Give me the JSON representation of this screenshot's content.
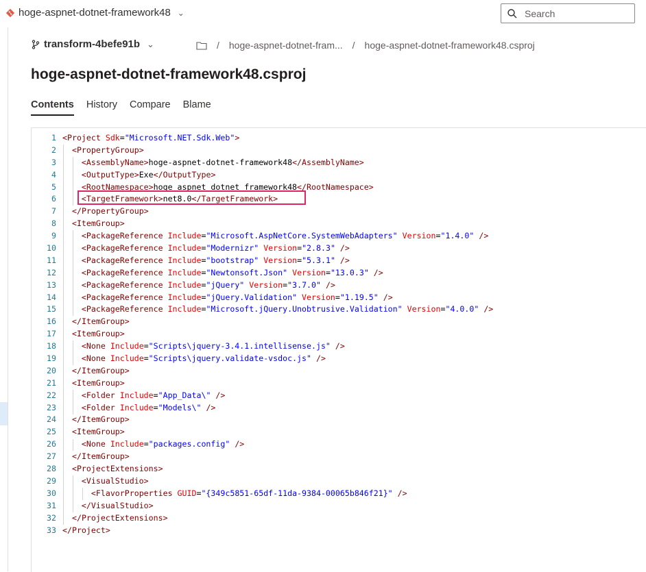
{
  "repo": {
    "name": "hoge-aspnet-dotnet-framework48"
  },
  "search": {
    "placeholder": "Search"
  },
  "branch": {
    "name": "transform-4befe91b"
  },
  "breadcrumb": {
    "folder": "hoge-aspnet-dotnet-fram...",
    "file": "hoge-aspnet-dotnet-framework48.csproj"
  },
  "page": {
    "title": "hoge-aspnet-dotnet-framework48.csproj"
  },
  "tabs": [
    {
      "label": "Contents",
      "active": true
    },
    {
      "label": "History",
      "active": false
    },
    {
      "label": "Compare",
      "active": false
    },
    {
      "label": "Blame",
      "active": false
    }
  ],
  "colors": {
    "highlight_box": "#e0245e",
    "tag": "#800000",
    "attribute": "#e50000",
    "string": "#0000ff",
    "line_number": "#237893"
  },
  "code_lines": [
    {
      "n": "1",
      "indent": 0,
      "parts": [
        [
          "p",
          "<"
        ],
        [
          "t",
          "Project"
        ],
        [
          "s",
          " "
        ],
        [
          "a",
          "Sdk"
        ],
        [
          "x",
          "="
        ],
        [
          "v",
          "\"Microsoft.NET.Sdk.Web\""
        ],
        [
          "p",
          ">"
        ]
      ]
    },
    {
      "n": "2",
      "indent": 1,
      "parts": [
        [
          "p",
          "<"
        ],
        [
          "t",
          "PropertyGroup"
        ],
        [
          "p",
          ">"
        ]
      ]
    },
    {
      "n": "3",
      "indent": 2,
      "parts": [
        [
          "p",
          "<"
        ],
        [
          "t",
          "AssemblyName"
        ],
        [
          "p",
          ">"
        ],
        [
          "x",
          "hoge-aspnet-dotnet-framework48"
        ],
        [
          "p",
          "</"
        ],
        [
          "t",
          "AssemblyName"
        ],
        [
          "p",
          ">"
        ]
      ]
    },
    {
      "n": "4",
      "indent": 2,
      "parts": [
        [
          "p",
          "<"
        ],
        [
          "t",
          "OutputType"
        ],
        [
          "p",
          ">"
        ],
        [
          "x",
          "Exe"
        ],
        [
          "p",
          "</"
        ],
        [
          "t",
          "OutputType"
        ],
        [
          "p",
          ">"
        ]
      ]
    },
    {
      "n": "5",
      "indent": 2,
      "parts": [
        [
          "p",
          "<"
        ],
        [
          "t",
          "RootNamespace"
        ],
        [
          "p",
          ">"
        ],
        [
          "x",
          "hoge_aspnet_dotnet_framework48"
        ],
        [
          "p",
          "</"
        ],
        [
          "t",
          "RootNamespace"
        ],
        [
          "p",
          ">"
        ]
      ]
    },
    {
      "n": "6",
      "indent": 2,
      "parts": [
        [
          "p",
          "<"
        ],
        [
          "t",
          "TargetFramework"
        ],
        [
          "p",
          ">"
        ],
        [
          "x",
          "net8.0"
        ],
        [
          "p",
          "</"
        ],
        [
          "t",
          "TargetFramework"
        ],
        [
          "p",
          ">"
        ]
      ]
    },
    {
      "n": "7",
      "indent": 1,
      "parts": [
        [
          "p",
          "</"
        ],
        [
          "t",
          "PropertyGroup"
        ],
        [
          "p",
          ">"
        ]
      ]
    },
    {
      "n": "8",
      "indent": 1,
      "parts": [
        [
          "p",
          "<"
        ],
        [
          "t",
          "ItemGroup"
        ],
        [
          "p",
          ">"
        ]
      ]
    },
    {
      "n": "9",
      "indent": 2,
      "parts": [
        [
          "p",
          "<"
        ],
        [
          "t",
          "PackageReference"
        ],
        [
          "s",
          " "
        ],
        [
          "a",
          "Include"
        ],
        [
          "x",
          "="
        ],
        [
          "v",
          "\"Microsoft.AspNetCore.SystemWebAdapters\""
        ],
        [
          "s",
          " "
        ],
        [
          "a",
          "Version"
        ],
        [
          "x",
          "="
        ],
        [
          "v",
          "\"1.4.0\""
        ],
        [
          "s",
          " "
        ],
        [
          "p",
          "/>"
        ]
      ]
    },
    {
      "n": "10",
      "indent": 2,
      "parts": [
        [
          "p",
          "<"
        ],
        [
          "t",
          "PackageReference"
        ],
        [
          "s",
          " "
        ],
        [
          "a",
          "Include"
        ],
        [
          "x",
          "="
        ],
        [
          "v",
          "\"Modernizr\""
        ],
        [
          "s",
          " "
        ],
        [
          "a",
          "Version"
        ],
        [
          "x",
          "="
        ],
        [
          "v",
          "\"2.8.3\""
        ],
        [
          "s",
          " "
        ],
        [
          "p",
          "/>"
        ]
      ]
    },
    {
      "n": "11",
      "indent": 2,
      "parts": [
        [
          "p",
          "<"
        ],
        [
          "t",
          "PackageReference"
        ],
        [
          "s",
          " "
        ],
        [
          "a",
          "Include"
        ],
        [
          "x",
          "="
        ],
        [
          "v",
          "\"bootstrap\""
        ],
        [
          "s",
          " "
        ],
        [
          "a",
          "Version"
        ],
        [
          "x",
          "="
        ],
        [
          "v",
          "\"5.3.1\""
        ],
        [
          "s",
          " "
        ],
        [
          "p",
          "/>"
        ]
      ]
    },
    {
      "n": "12",
      "indent": 2,
      "parts": [
        [
          "p",
          "<"
        ],
        [
          "t",
          "PackageReference"
        ],
        [
          "s",
          " "
        ],
        [
          "a",
          "Include"
        ],
        [
          "x",
          "="
        ],
        [
          "v",
          "\"Newtonsoft.Json\""
        ],
        [
          "s",
          " "
        ],
        [
          "a",
          "Version"
        ],
        [
          "x",
          "="
        ],
        [
          "v",
          "\"13.0.3\""
        ],
        [
          "s",
          " "
        ],
        [
          "p",
          "/>"
        ]
      ]
    },
    {
      "n": "13",
      "indent": 2,
      "parts": [
        [
          "p",
          "<"
        ],
        [
          "t",
          "PackageReference"
        ],
        [
          "s",
          " "
        ],
        [
          "a",
          "Include"
        ],
        [
          "x",
          "="
        ],
        [
          "v",
          "\"jQuery\""
        ],
        [
          "s",
          " "
        ],
        [
          "a",
          "Version"
        ],
        [
          "x",
          "="
        ],
        [
          "v",
          "\"3.7.0\""
        ],
        [
          "s",
          " "
        ],
        [
          "p",
          "/>"
        ]
      ]
    },
    {
      "n": "14",
      "indent": 2,
      "parts": [
        [
          "p",
          "<"
        ],
        [
          "t",
          "PackageReference"
        ],
        [
          "s",
          " "
        ],
        [
          "a",
          "Include"
        ],
        [
          "x",
          "="
        ],
        [
          "v",
          "\"jQuery.Validation\""
        ],
        [
          "s",
          " "
        ],
        [
          "a",
          "Version"
        ],
        [
          "x",
          "="
        ],
        [
          "v",
          "\"1.19.5\""
        ],
        [
          "s",
          " "
        ],
        [
          "p",
          "/>"
        ]
      ]
    },
    {
      "n": "15",
      "indent": 2,
      "parts": [
        [
          "p",
          "<"
        ],
        [
          "t",
          "PackageReference"
        ],
        [
          "s",
          " "
        ],
        [
          "a",
          "Include"
        ],
        [
          "x",
          "="
        ],
        [
          "v",
          "\"Microsoft.jQuery.Unobtrusive.Validation\""
        ],
        [
          "s",
          " "
        ],
        [
          "a",
          "Version"
        ],
        [
          "x",
          "="
        ],
        [
          "v",
          "\"4.0.0\""
        ],
        [
          "s",
          " "
        ],
        [
          "p",
          "/>"
        ]
      ]
    },
    {
      "n": "16",
      "indent": 1,
      "parts": [
        [
          "p",
          "</"
        ],
        [
          "t",
          "ItemGroup"
        ],
        [
          "p",
          ">"
        ]
      ]
    },
    {
      "n": "17",
      "indent": 1,
      "parts": [
        [
          "p",
          "<"
        ],
        [
          "t",
          "ItemGroup"
        ],
        [
          "p",
          ">"
        ]
      ]
    },
    {
      "n": "18",
      "indent": 2,
      "parts": [
        [
          "p",
          "<"
        ],
        [
          "t",
          "None"
        ],
        [
          "s",
          " "
        ],
        [
          "a",
          "Include"
        ],
        [
          "x",
          "="
        ],
        [
          "v",
          "\"Scripts\\jquery-3.4.1.intellisense.js\""
        ],
        [
          "s",
          " "
        ],
        [
          "p",
          "/>"
        ]
      ]
    },
    {
      "n": "19",
      "indent": 2,
      "parts": [
        [
          "p",
          "<"
        ],
        [
          "t",
          "None"
        ],
        [
          "s",
          " "
        ],
        [
          "a",
          "Include"
        ],
        [
          "x",
          "="
        ],
        [
          "v",
          "\"Scripts\\jquery.validate-vsdoc.js\""
        ],
        [
          "s",
          " "
        ],
        [
          "p",
          "/>"
        ]
      ]
    },
    {
      "n": "20",
      "indent": 1,
      "parts": [
        [
          "p",
          "</"
        ],
        [
          "t",
          "ItemGroup"
        ],
        [
          "p",
          ">"
        ]
      ]
    },
    {
      "n": "21",
      "indent": 1,
      "parts": [
        [
          "p",
          "<"
        ],
        [
          "t",
          "ItemGroup"
        ],
        [
          "p",
          ">"
        ]
      ]
    },
    {
      "n": "22",
      "indent": 2,
      "parts": [
        [
          "p",
          "<"
        ],
        [
          "t",
          "Folder"
        ],
        [
          "s",
          " "
        ],
        [
          "a",
          "Include"
        ],
        [
          "x",
          "="
        ],
        [
          "v",
          "\"App_Data\\\""
        ],
        [
          "s",
          " "
        ],
        [
          "p",
          "/>"
        ]
      ]
    },
    {
      "n": "23",
      "indent": 2,
      "parts": [
        [
          "p",
          "<"
        ],
        [
          "t",
          "Folder"
        ],
        [
          "s",
          " "
        ],
        [
          "a",
          "Include"
        ],
        [
          "x",
          "="
        ],
        [
          "v",
          "\"Models\\\""
        ],
        [
          "s",
          " "
        ],
        [
          "p",
          "/>"
        ]
      ]
    },
    {
      "n": "24",
      "indent": 1,
      "parts": [
        [
          "p",
          "</"
        ],
        [
          "t",
          "ItemGroup"
        ],
        [
          "p",
          ">"
        ]
      ]
    },
    {
      "n": "25",
      "indent": 1,
      "parts": [
        [
          "p",
          "<"
        ],
        [
          "t",
          "ItemGroup"
        ],
        [
          "p",
          ">"
        ]
      ]
    },
    {
      "n": "26",
      "indent": 2,
      "parts": [
        [
          "p",
          "<"
        ],
        [
          "t",
          "None"
        ],
        [
          "s",
          " "
        ],
        [
          "a",
          "Include"
        ],
        [
          "x",
          "="
        ],
        [
          "v",
          "\"packages.config\""
        ],
        [
          "s",
          " "
        ],
        [
          "p",
          "/>"
        ]
      ]
    },
    {
      "n": "27",
      "indent": 1,
      "parts": [
        [
          "p",
          "</"
        ],
        [
          "t",
          "ItemGroup"
        ],
        [
          "p",
          ">"
        ]
      ]
    },
    {
      "n": "28",
      "indent": 1,
      "parts": [
        [
          "p",
          "<"
        ],
        [
          "t",
          "ProjectExtensions"
        ],
        [
          "p",
          ">"
        ]
      ]
    },
    {
      "n": "29",
      "indent": 2,
      "parts": [
        [
          "p",
          "<"
        ],
        [
          "t",
          "VisualStudio"
        ],
        [
          "p",
          ">"
        ]
      ]
    },
    {
      "n": "30",
      "indent": 3,
      "parts": [
        [
          "p",
          "<"
        ],
        [
          "t",
          "FlavorProperties"
        ],
        [
          "s",
          " "
        ],
        [
          "a",
          "GUID"
        ],
        [
          "x",
          "="
        ],
        [
          "v",
          "\"{349c5851-65df-11da-9384-00065b846f21}\""
        ],
        [
          "s",
          " "
        ],
        [
          "p",
          "/>"
        ]
      ]
    },
    {
      "n": "31",
      "indent": 2,
      "parts": [
        [
          "p",
          "</"
        ],
        [
          "t",
          "VisualStudio"
        ],
        [
          "p",
          ">"
        ]
      ]
    },
    {
      "n": "32",
      "indent": 1,
      "parts": [
        [
          "p",
          "</"
        ],
        [
          "t",
          "ProjectExtensions"
        ],
        [
          "p",
          ">"
        ]
      ]
    },
    {
      "n": "33",
      "indent": 0,
      "parts": [
        [
          "p",
          "</"
        ],
        [
          "t",
          "Project"
        ],
        [
          "p",
          ">"
        ]
      ]
    }
  ]
}
